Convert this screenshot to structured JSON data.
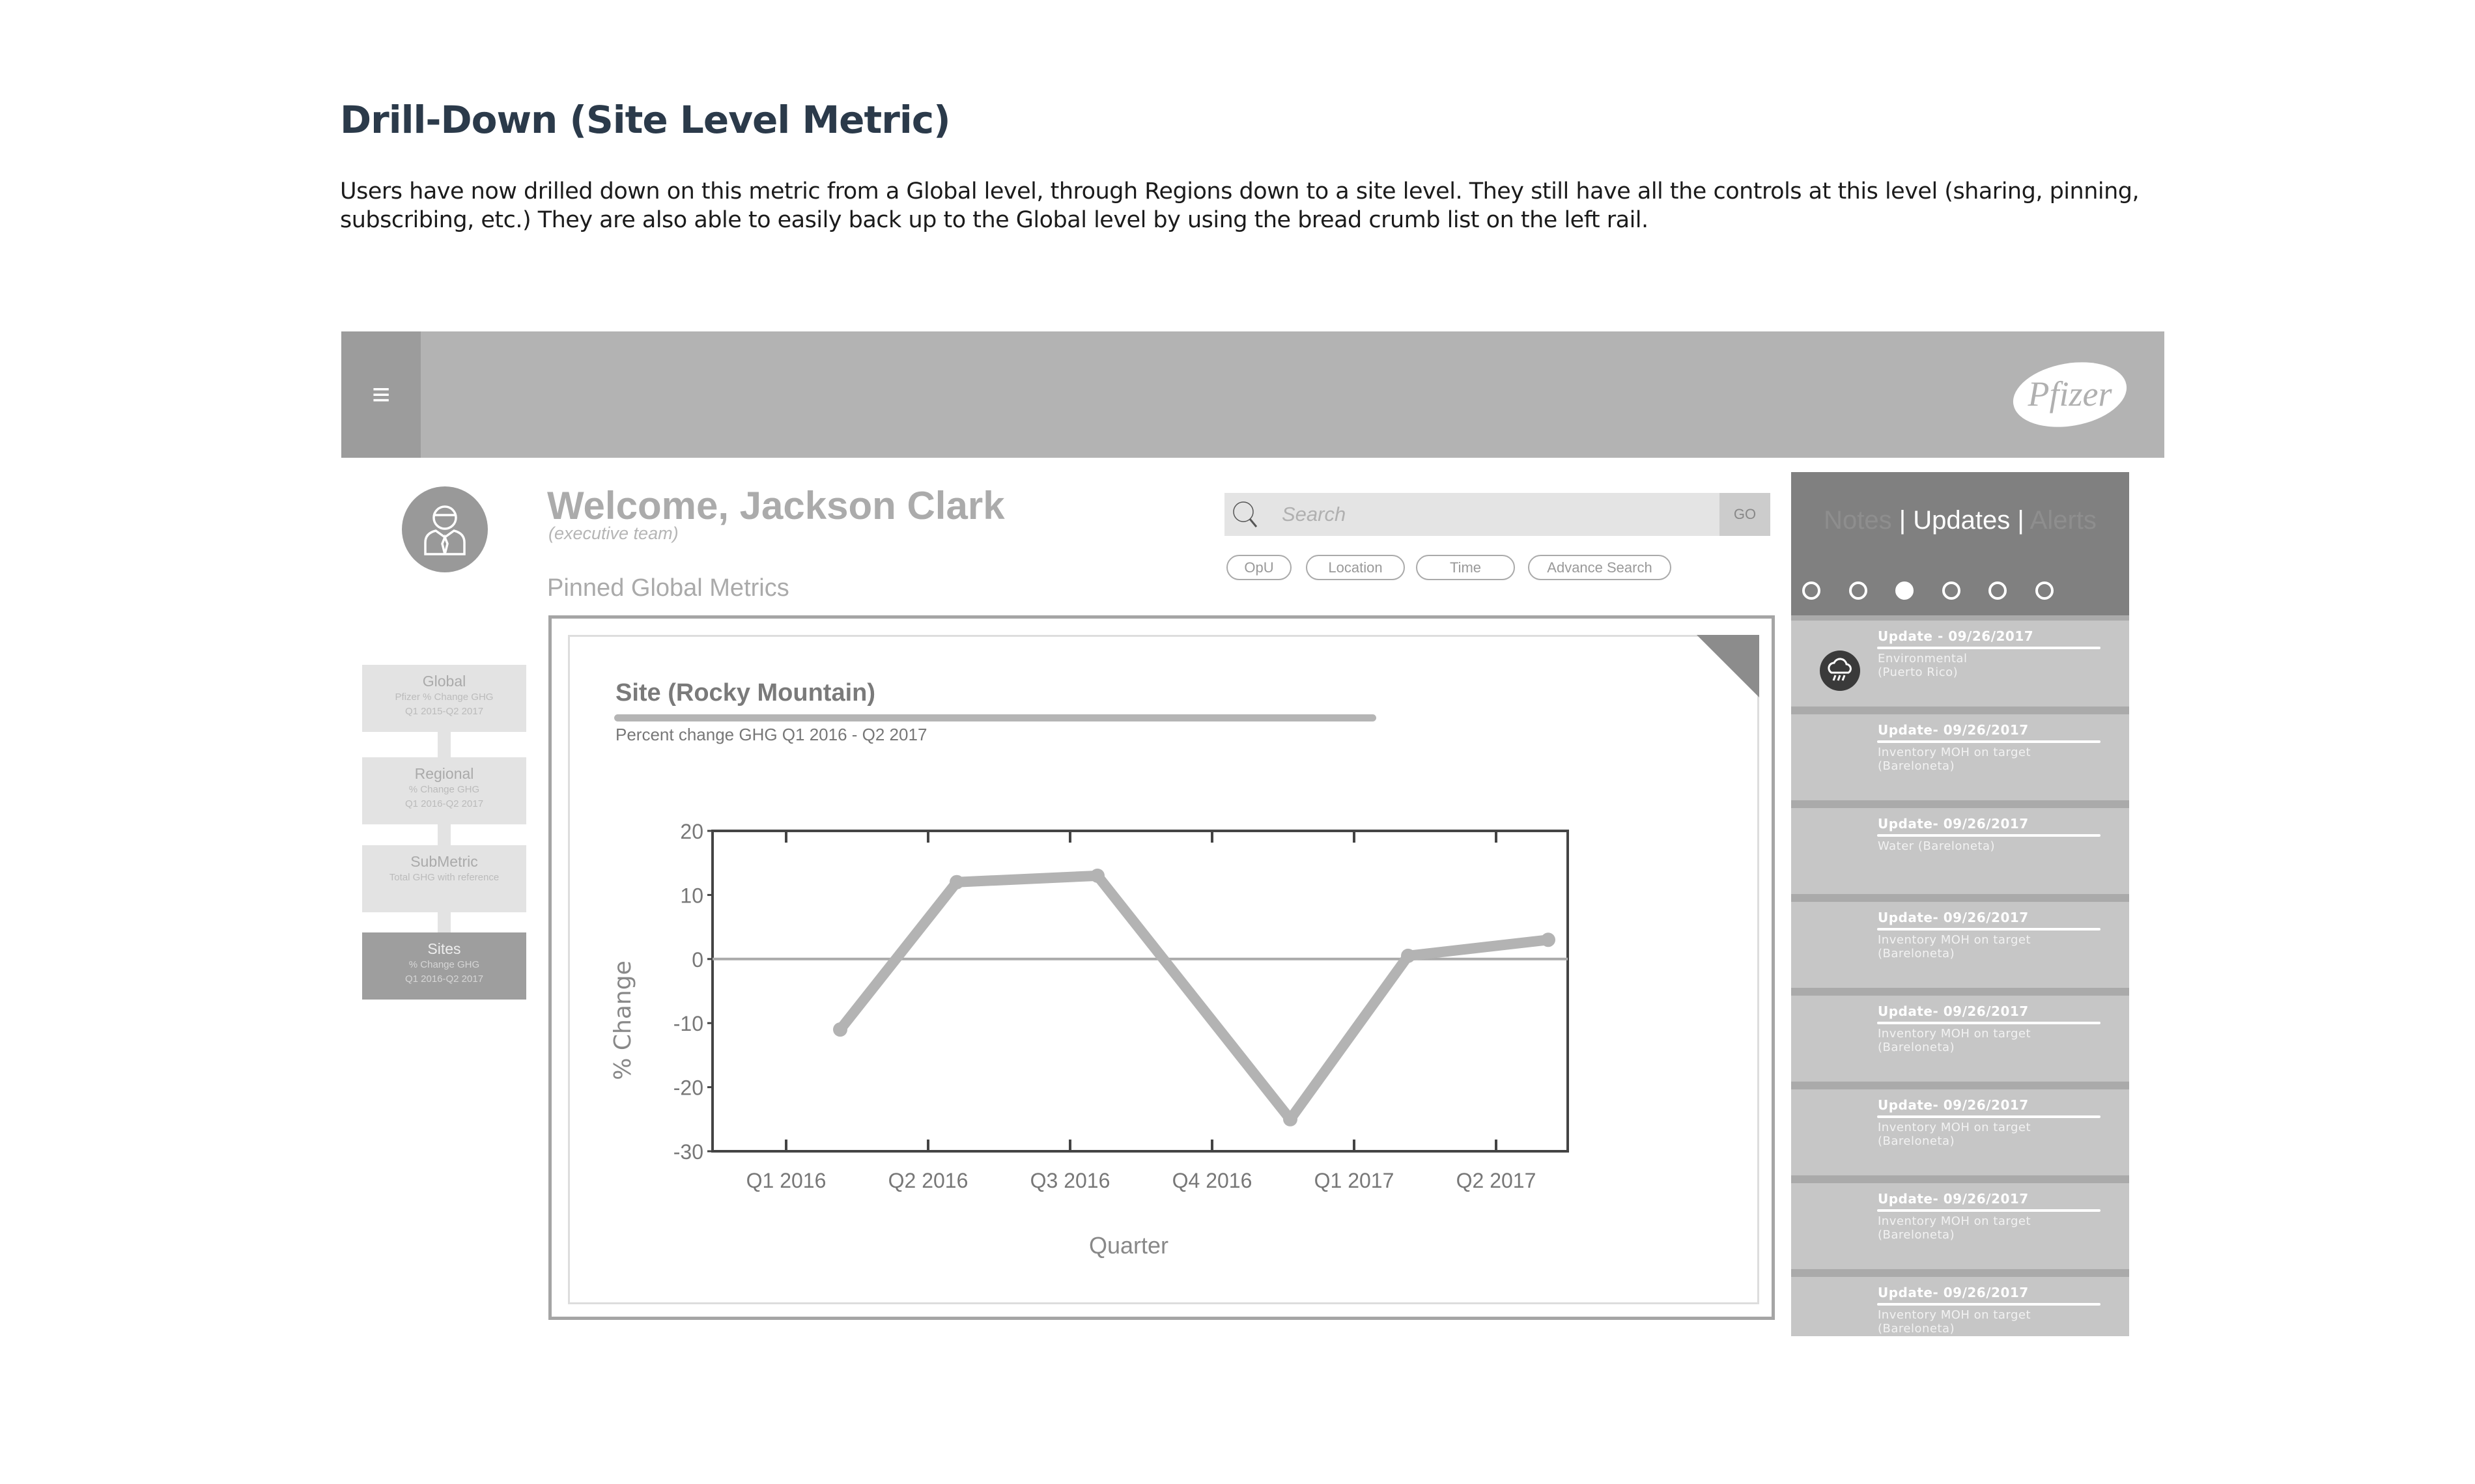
{
  "document": {
    "title": "Drill-Down (Site Level Metric)",
    "description": "Users have now drilled down on this metric from a Global level, through Regions down to a site level. They still  have all the controls at this level (sharing, pinning, subscribing, etc.) They are also able to easily back up to the Global level by using the bread crumb list on the left rail."
  },
  "header": {
    "menu_icon": "hamburger-icon",
    "logo_text": "Pfizer"
  },
  "user": {
    "welcome": "Welcome, Jackson Clark",
    "team": "(executive team)",
    "avatar_icon": "businessman-icon"
  },
  "section_title": "Pinned Global Metrics",
  "search": {
    "placeholder": "Search",
    "go_label": "GO",
    "filters": [
      "OpU",
      "Location",
      "Time",
      "Advance Search"
    ]
  },
  "breadcrumb": [
    {
      "title": "Global",
      "lines": [
        "Pfizer % Change GHG",
        "Q1 2015-Q2 2017"
      ],
      "active": false
    },
    {
      "title": "Regional",
      "lines": [
        "% Change GHG",
        "Q1 2016-Q2 2017"
      ],
      "active": false
    },
    {
      "title": "SubMetric",
      "lines": [
        "Total GHG with reference",
        ""
      ],
      "active": false
    },
    {
      "title": "Sites",
      "lines": [
        "% Change GHG",
        "Q1 2016-Q2 2017"
      ],
      "active": true
    }
  ],
  "right_panel": {
    "tabs": [
      "Notes",
      "Updates",
      "Alerts"
    ],
    "tab_separator": "|",
    "active_tab": "Updates",
    "pager": {
      "pages": 6,
      "active_index": 2
    },
    "updates": [
      {
        "title": "Update - 09/26/2017",
        "line1": "Environmental",
        "line2": "(Puerto Rico)",
        "icon": "rain-cloud-icon"
      },
      {
        "title": "Update- 09/26/2017",
        "line1": "Inventory MOH on target",
        "line2": "(Bareloneta)"
      },
      {
        "title": "Update- 09/26/2017",
        "line1": "Water (Bareloneta)",
        "line2": ""
      },
      {
        "title": "Update- 09/26/2017",
        "line1": "Inventory MOH on target",
        "line2": "(Bareloneta)"
      },
      {
        "title": "Update- 09/26/2017",
        "line1": "Inventory MOH on target",
        "line2": "(Bareloneta)"
      },
      {
        "title": "Update- 09/26/2017",
        "line1": "Inventory MOH on target",
        "line2": "(Bareloneta)"
      },
      {
        "title": "Update- 09/26/2017",
        "line1": "Inventory MOH on target",
        "line2": "(Bareloneta)"
      },
      {
        "title": "Update- 09/26/2017",
        "line1": "Inventory MOH on target",
        "line2": "(Bareloneta)"
      }
    ]
  },
  "card": {
    "title": "Site (Rocky Mountain)",
    "subtitle": "Percent change GHG Q1 2016 - Q2 2017"
  },
  "chart_data": {
    "type": "line",
    "categories": [
      "Q1 2016",
      "Q2 2016",
      "Q3 2016",
      "Q4 2016",
      "Q1 2017",
      "Q2 2017"
    ],
    "values": [
      -11,
      12,
      13,
      -25,
      0.5,
      3
    ],
    "xlabel": "Quarter",
    "ylabel": "% Change",
    "ylim": [
      -30,
      20
    ],
    "yticks": [
      20,
      10,
      0,
      -10,
      -20,
      -30
    ],
    "zero_line": true,
    "grid": false,
    "line_color": "#b3b3b3"
  }
}
